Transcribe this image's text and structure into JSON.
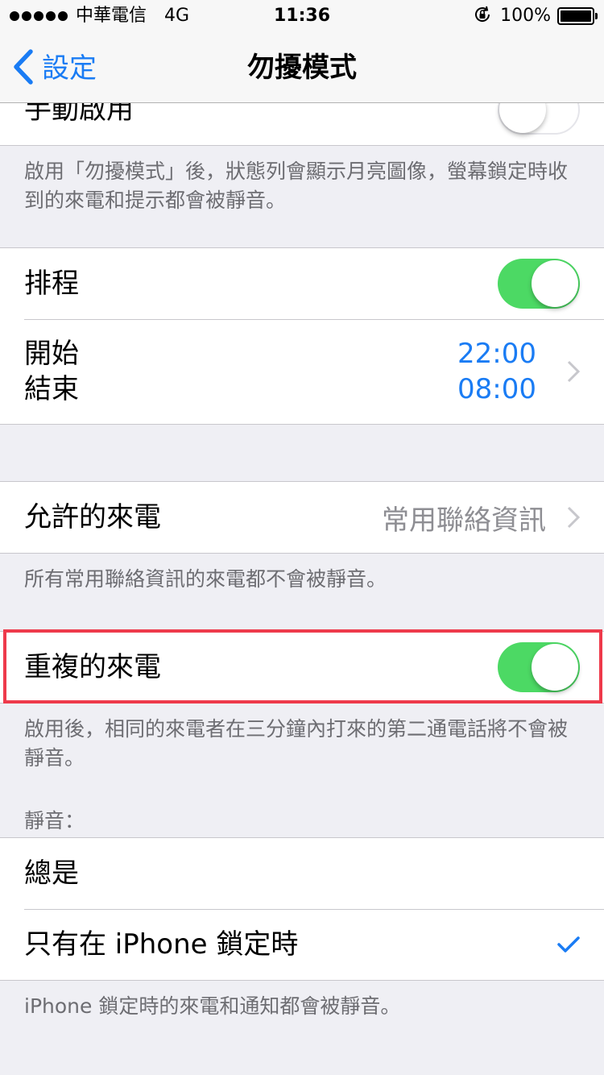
{
  "status_bar": {
    "carrier": "中華電信",
    "network": "4G",
    "time": "11:36",
    "battery_percent": "100%"
  },
  "nav": {
    "back_label": "設定",
    "title": "勿擾模式"
  },
  "manual": {
    "label": "手動啟用",
    "enabled": false,
    "footer": "啟用「勿擾模式」後，狀態列會顯示月亮圖像，螢幕鎖定時收到的來電和提示都會被靜音。"
  },
  "schedule": {
    "label": "排程",
    "enabled": true,
    "start_label": "開始",
    "end_label": "結束",
    "start_time": "22:00",
    "end_time": "08:00"
  },
  "allow_calls": {
    "label": "允許的來電",
    "value": "常用聯絡資訊",
    "footer": "所有常用聯絡資訊的來電都不會被靜音。"
  },
  "repeated_calls": {
    "label": "重複的來電",
    "enabled": true,
    "footer": "啟用後，相同的來電者在三分鐘內打來的第二通電話將不會被靜音。"
  },
  "silence": {
    "header": "靜音：",
    "options": [
      {
        "label": "總是",
        "selected": false
      },
      {
        "label": "只有在 iPhone 鎖定時",
        "selected": true
      }
    ],
    "footer": "iPhone 鎖定時的來電和通知都會被靜音。"
  },
  "colors": {
    "accent_blue": "#1a7cf4",
    "toggle_green": "#4cd964",
    "highlight_red": "#ee3a4b",
    "background": "#efeff4"
  }
}
